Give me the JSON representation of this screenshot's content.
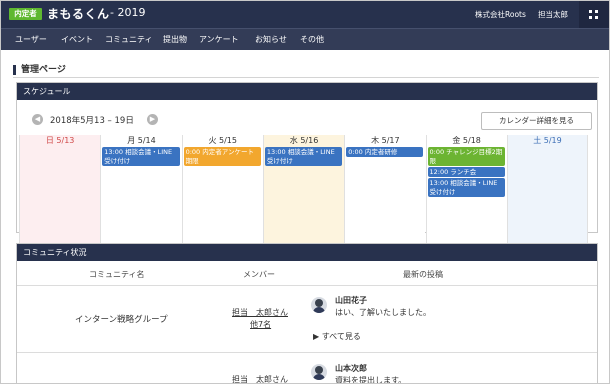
{
  "header": {
    "logo_badge": "内定者",
    "logo_text": "まもるくん",
    "logo_year": "- 2019",
    "company": "株式会社Roots",
    "user": "担当太郎"
  },
  "nav": [
    "ユーザー",
    "イベント",
    "コミュニティ",
    "提出物",
    "アンケート",
    "お知らせ",
    "その他"
  ],
  "page_title": "管理ページ",
  "schedule": {
    "title": "スケジュール",
    "range": "2018年5月13 – 19日",
    "calendar_button": "カレンダー詳細を見る",
    "days": [
      {
        "label": "日 5/13",
        "color": "#d04848",
        "bg": "#fdeef0",
        "events": []
      },
      {
        "label": "月 5/14",
        "color": "#333333",
        "bg": "#ffffff",
        "events": [
          {
            "text": "13:00 相談会議・LINE受け付け",
            "color": "blue"
          }
        ]
      },
      {
        "label": "火 5/15",
        "color": "#333333",
        "bg": "#ffffff",
        "events": [
          {
            "text": "0:00 内定者アンケート期限",
            "color": "orange"
          }
        ]
      },
      {
        "label": "水 5/16",
        "color": "#333333",
        "bg": "#fdf4de",
        "events": [
          {
            "text": "13:00 相談会議・LINE受け付け",
            "color": "blue"
          }
        ]
      },
      {
        "label": "木 5/17",
        "color": "#333333",
        "bg": "#ffffff",
        "events": [
          {
            "text": "0:00 内定者研修",
            "color": "blue"
          }
        ]
      },
      {
        "label": "金 5/18",
        "color": "#333333",
        "bg": "#ffffff",
        "events": [
          {
            "text": "0:00 チャレンジ目標2期限",
            "color": "green"
          },
          {
            "text": "12:00 ランチ会",
            "color": "blue"
          },
          {
            "text": "13:00 相談会議・LINE受け付け",
            "color": "blue"
          }
        ]
      },
      {
        "label": "土 5/19",
        "color": "#3d6fb6",
        "bg": "#eef4fb",
        "events": []
      }
    ]
  },
  "community": {
    "title": "コミュニティ状況",
    "columns": [
      "コミュニティ名",
      "メンバー",
      "最新の投稿"
    ],
    "rows": [
      {
        "name": "インターン戦略グループ",
        "member": "担当　太郎さん",
        "member_more": "他7名",
        "poster": "山田花子",
        "message": "はい、了解いたしました。",
        "see_all": "▶ すべて見る"
      },
      {
        "name": "",
        "member": "担当　太郎さん",
        "member_more": "",
        "poster": "山本次郎",
        "message": "資料を提出します。",
        "see_all": ""
      }
    ]
  }
}
